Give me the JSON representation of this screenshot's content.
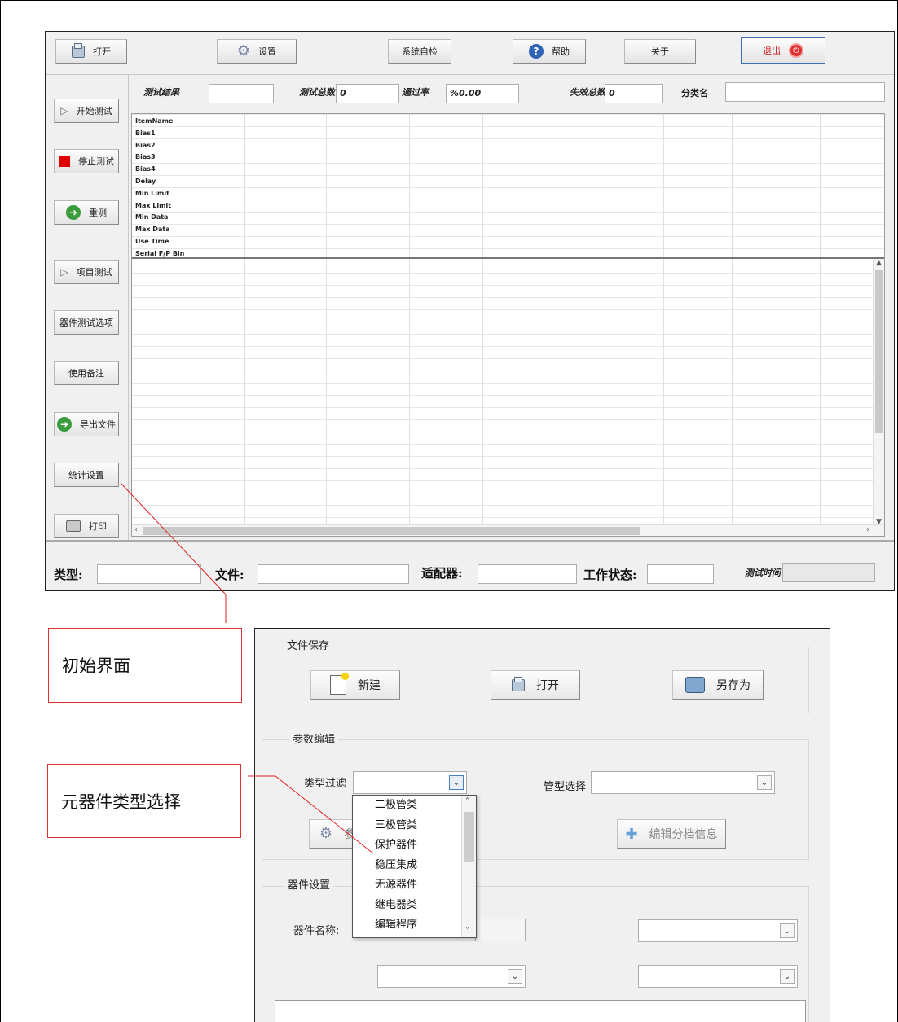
{
  "toolbar": {
    "open": "打开",
    "settings": "设置",
    "selfcheck": "系统自检",
    "help": "帮助",
    "about": "关于",
    "exit": "退出"
  },
  "sidebar": {
    "start_test": "开始测试",
    "stop_test": "停止测试",
    "retest": "重测",
    "item_test": "项目测试",
    "device_options": "器件测试选项",
    "usage_notes": "使用备注",
    "export_file": "导出文件",
    "stats_settings": "统计设置",
    "print": "打印"
  },
  "summary": {
    "result_label": "测试结果",
    "result_value": "",
    "total_label": "测试总数",
    "total_value": "0",
    "pass_rate_label": "通过率",
    "pass_rate_value": "%0.00",
    "fail_label": "失效总数",
    "fail_value": "0",
    "category_label": "分类名",
    "category_value": ""
  },
  "grid": {
    "row_headers": [
      "ItemName",
      "Bias1",
      "Bias2",
      "Bias3",
      "Bias4",
      "Delay",
      "Min Limit",
      "Max Limit",
      "Min Data",
      "Max Data",
      "Use Time",
      "Serial  F/P    Bin"
    ]
  },
  "statusbar": {
    "type_label": "类型:",
    "file_label": "文件:",
    "adapter_label": "适配器:",
    "state_label": "工作状态:",
    "time_label": "测试时间"
  },
  "callouts": {
    "initial": "初始界面",
    "component_type": "元器件类型选择"
  },
  "dialog": {
    "file_group": "文件保存",
    "new": "新建",
    "open": "打开",
    "save_as": "另存为",
    "param_group": "参数编辑",
    "type_filter_label": "类型过滤",
    "tube_select_label": "管型选择",
    "edit_bins": "编辑分档信息",
    "param_btn_partial": "参",
    "device_group": "器件设置",
    "device_name_label": "器件名称:",
    "type_options": [
      "二极管类",
      "三极管类",
      "保护器件",
      "稳压集成",
      "无源器件",
      "继电器类",
      "编辑程序"
    ]
  }
}
